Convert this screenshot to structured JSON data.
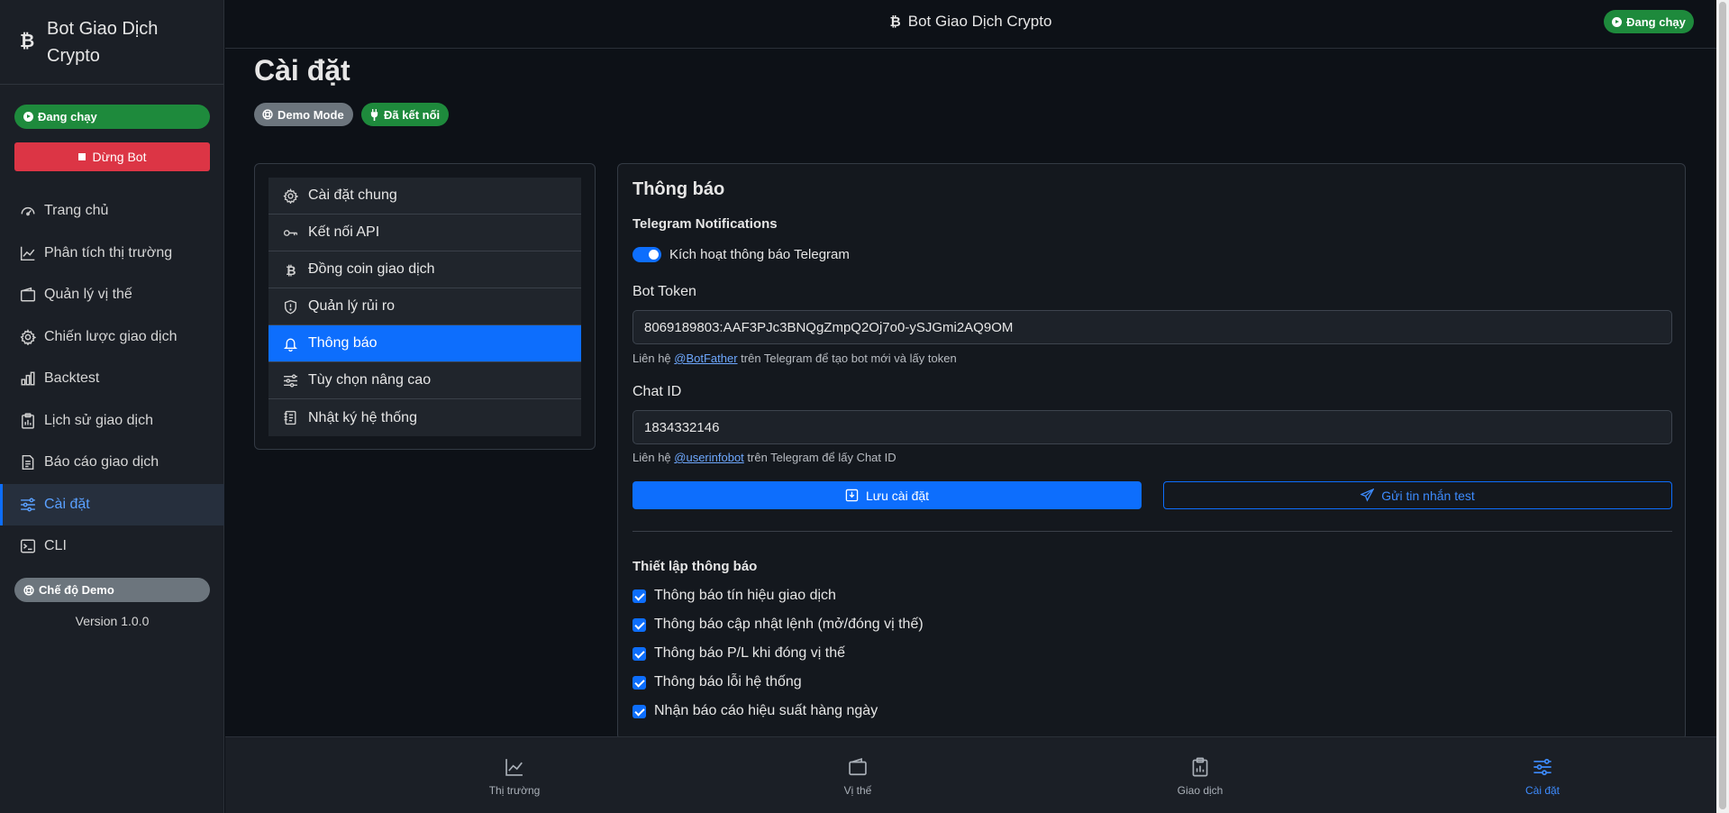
{
  "app": {
    "title": "Bot Giao Dịch Crypto",
    "logo": "₿"
  },
  "sidebar": {
    "status": "Đang chạy",
    "stop_button": "Dừng Bot",
    "items": [
      {
        "label": "Trang chủ",
        "icon": "speedometer-icon"
      },
      {
        "label": "Phân tích thị trường",
        "icon": "chart-line-icon"
      },
      {
        "label": "Quản lý vị thế",
        "icon": "wallet-icon"
      },
      {
        "label": "Chiến lược giao dịch",
        "icon": "gear-icon"
      },
      {
        "label": "Backtest",
        "icon": "bar-chart-icon"
      },
      {
        "label": "Lịch sử giao dịch",
        "icon": "clipboard-data-icon"
      },
      {
        "label": "Báo cáo giao dịch",
        "icon": "file-text-icon"
      },
      {
        "label": "Cài đặt",
        "icon": "sliders-icon",
        "active": true
      },
      {
        "label": "CLI",
        "icon": "terminal-icon"
      }
    ],
    "demo_badge": "Chế độ Demo",
    "version": "Version 1.0.0"
  },
  "topbar": {
    "title": "Bot Giao Dịch Crypto",
    "status": "Đang chạy"
  },
  "page": {
    "title": "Cài đặt",
    "badges": {
      "demo": "Demo Mode",
      "connected": "Đã kết nối"
    }
  },
  "settings_menu": [
    {
      "label": "Cài đặt chung",
      "icon": "gear-icon"
    },
    {
      "label": "Kết nối API",
      "icon": "key-icon"
    },
    {
      "label": "Đồng coin giao dịch",
      "icon": "bitcoin-icon"
    },
    {
      "label": "Quản lý rủi ro",
      "icon": "shield-icon"
    },
    {
      "label": "Thông báo",
      "icon": "bell-icon",
      "active": true
    },
    {
      "label": "Tùy chọn nâng cao",
      "icon": "sliders-icon"
    },
    {
      "label": "Nhật ký hệ thống",
      "icon": "journal-icon"
    }
  ],
  "notifications": {
    "heading": "Thông báo",
    "telegram_heading": "Telegram Notifications",
    "enable_label": "Kích hoạt thông báo Telegram",
    "enabled": true,
    "bot_token_label": "Bot Token",
    "bot_token_value": "8069189803:AAF3PJc3BNQgZmpQ2Oj7o0-ySJGmi2AQ9OM",
    "bot_token_help_pre": "Liên hệ ",
    "bot_token_help_link": "@BotFather",
    "bot_token_help_post": " trên Telegram để tạo bot mới và lấy token",
    "chat_id_label": "Chat ID",
    "chat_id_value": "1834332146",
    "chat_id_help_pre": "Liên hệ ",
    "chat_id_help_link": "@userinfobot",
    "chat_id_help_post": " trên Telegram để lấy Chat ID",
    "save_button": "Lưu cài đặt",
    "test_button": "Gửi tin nhắn test",
    "setup_heading": "Thiết lập thông báo",
    "options": [
      {
        "label": "Thông báo tín hiệu giao dịch",
        "checked": true
      },
      {
        "label": "Thông báo cập nhật lệnh (mở/đóng vị thế)",
        "checked": true
      },
      {
        "label": "Thông báo P/L khi đóng vị thế",
        "checked": true
      },
      {
        "label": "Thông báo lỗi hệ thống",
        "checked": true
      },
      {
        "label": "Nhận báo cáo hiệu suất hàng ngày",
        "checked": true
      }
    ]
  },
  "bottom_nav": [
    {
      "label": "Thị trường",
      "icon": "chart-line-icon"
    },
    {
      "label": "Vị thế",
      "icon": "wallet-icon"
    },
    {
      "label": "Giao dịch",
      "icon": "clipboard-data-icon"
    },
    {
      "label": "Cài đặt",
      "icon": "sliders-icon",
      "active": true
    }
  ],
  "colors": {
    "accent": "#0d6efd",
    "success": "#1e8a3c",
    "danger": "#dc3545",
    "muted": "#6c757d"
  }
}
